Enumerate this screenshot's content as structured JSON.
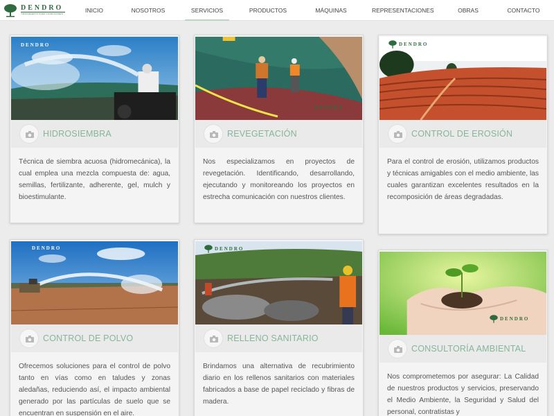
{
  "brand": {
    "name": "DENDRO",
    "tagline": "TRATAMIENTO PARA CONDICIONES"
  },
  "nav": {
    "items": [
      "INICIO",
      "NOSOTROS",
      "SERVICIOS",
      "PRODUCTOS",
      "MÁQUINAS",
      "REPRESENTACIONES",
      "OBRAS",
      "CONTACTO"
    ],
    "active": "SERVICIOS"
  },
  "services": [
    {
      "title": "HIDROSIEMBRA",
      "text": "Técnica de siembra acuosa (hidromecánica), la cual emplea una mezcla compuesta de: agua, semillas, fertilizante, adherente, gel, mulch y bioestimulante."
    },
    {
      "title": "REVEGETACIÓN",
      "text": "Nos especializamos en proyectos de revegetación. Identificando, desarrollando, ejecutando y monitoreando los proyectos en estrecha comunicación con nuestros clientes."
    },
    {
      "title": "CONTROL DE EROSIÓN",
      "text": "Para el control de erosión, utilizamos productos y técnicas amigables con el medio ambiente, las cuales garantizan excelentes resultados en la recomposición de áreas degradadas."
    },
    {
      "title": "CONTROL DE POLVO",
      "text": "Ofrecemos soluciones para el control de polvo tanto en vías como en taludes y zonas aledañas, reduciendo así, el impacto ambiental generado por las partículas de suelo que se encuentran en suspensión en el aire."
    },
    {
      "title": "RELLENO SANITARIO",
      "text": "Brindamos una alternativa de recubrimiento diario en los rellenos sanitarios con materiales fabricados a base de papel reciclado y fibras de madera."
    },
    {
      "title": "CONSULTORÍA AMBIENTAL",
      "text": "Nos comprometemos por asegurar: La Calidad de nuestros productos y servicios, preservando el Medio Ambiente, la Seguridad y Salud del personal, contratistas y"
    }
  ],
  "colors": {
    "accent": "#86b59a",
    "brand": "#2f6b3f",
    "background": "#ececec"
  }
}
